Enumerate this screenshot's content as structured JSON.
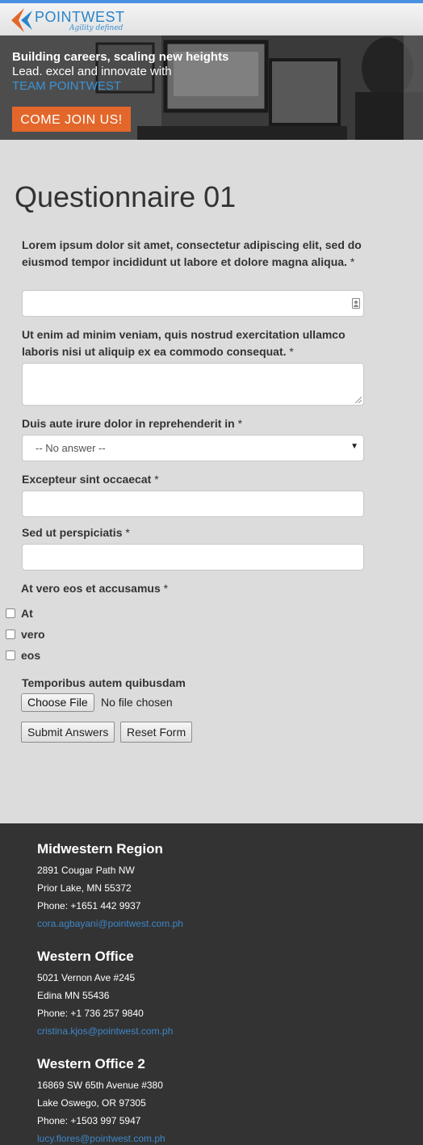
{
  "brand": {
    "name": "POINTWEST",
    "tagline": "Agility defined",
    "colors": {
      "primary": "#2a85c8",
      "accent": "#e3672a",
      "footer": "#333333"
    }
  },
  "hero": {
    "title": "Building careers, scaling new heights",
    "subtitle": "Lead. excel and innovate with",
    "team": "TEAM POINTWEST",
    "cta": "COME JOIN US!"
  },
  "page": {
    "title": "Questionnaire 01"
  },
  "questions": [
    {
      "label": "Lorem ipsum dolor sit amet, consectetur adipiscing elit, sed do eiusmod tempor incididunt ut labore et dolore magna aliqua.",
      "required": "*",
      "type": "text",
      "value": "",
      "icon": "contact-card-icon"
    },
    {
      "label": "Ut enim ad minim veniam, quis nostrud exercitation ullamco laboris nisi ut aliquip ex ea commodo consequat.",
      "required": "*",
      "type": "textarea",
      "value": ""
    },
    {
      "label": "Duis aute irure dolor in reprehenderit in",
      "required": "*",
      "type": "select",
      "selected": "-- No answer --"
    },
    {
      "label": "Excepteur sint occaecat",
      "required": "*",
      "type": "text",
      "value": ""
    },
    {
      "label": "Sed ut perspiciatis",
      "required": "*",
      "type": "text",
      "value": ""
    },
    {
      "label": "At vero eos et accusamus",
      "required": "*",
      "type": "checkbox",
      "options": [
        "At",
        "vero",
        "eos"
      ]
    },
    {
      "label": "Temporibus autem quibusdam",
      "type": "file",
      "button": "Choose File",
      "status": "No file chosen"
    }
  ],
  "actions": {
    "submit": "Submit Answers",
    "reset": "Reset Form"
  },
  "offices": [
    {
      "name": "Midwestern Region",
      "street": "2891 Cougar Path NW",
      "city": "Prior Lake, MN 55372",
      "phone": "Phone: +1651 442 9937",
      "email": "cora.agbayani@pointwest.com.ph"
    },
    {
      "name": "Western Office",
      "street": "5021 Vernon Ave #245",
      "city": "Edina MN 55436",
      "phone": "Phone: +1 736 257 9840",
      "email": "cristina.kjos@pointwest.com.ph"
    },
    {
      "name": "Western Office 2",
      "street": "16869 SW 65th Avenue #380",
      "city": "Lake Oswego, OR 97305",
      "phone": "Phone: +1503 997 5947",
      "email": "lucy.flores@pointwest.com.ph"
    }
  ]
}
